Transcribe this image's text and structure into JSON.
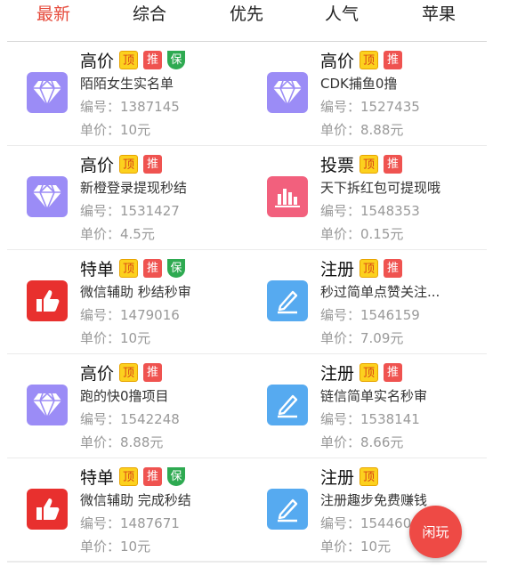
{
  "tabs": [
    {
      "label": "最新",
      "active": true
    },
    {
      "label": "综合",
      "active": false
    },
    {
      "label": "优先",
      "active": false
    },
    {
      "label": "人气",
      "active": false
    },
    {
      "label": "苹果",
      "active": false
    }
  ],
  "colors": {
    "accent": "#e64a3b",
    "diamond": "#9b8cf6",
    "chart": "#f2607d",
    "thumb": "#e8302e",
    "pen": "#56aaf0",
    "ding": "#fcd11e",
    "tui": "#ef5350",
    "bao": "#2eaa51"
  },
  "badge_labels": {
    "ding": "顶",
    "tui": "推",
    "bao": "保"
  },
  "labels": {
    "num_prefix": "编号：",
    "price_prefix": "单价："
  },
  "items": [
    {
      "title": "高价",
      "badges": [
        "ding",
        "tui",
        "bao"
      ],
      "icon": "diamond-icon",
      "desc": "陌陌女生实名单",
      "num": "编号：1387145",
      "price": "单价：10元"
    },
    {
      "title": "高价",
      "badges": [
        "ding",
        "tui"
      ],
      "icon": "diamond-icon",
      "desc": "CDK捕鱼0撸",
      "num": "编号：1527435",
      "price": "单价：8.88元"
    },
    {
      "title": "高价",
      "badges": [
        "ding",
        "tui"
      ],
      "icon": "diamond-icon",
      "desc": "新橙登录提现秒结",
      "num": "编号：1531427",
      "price": "单价：4.5元"
    },
    {
      "title": "投票",
      "badges": [
        "ding",
        "tui"
      ],
      "icon": "bar-chart-icon",
      "desc": "天下拆红包可提现哦",
      "num": "编号：1548353",
      "price": "单价：0.15元"
    },
    {
      "title": "特单",
      "badges": [
        "ding",
        "tui",
        "bao"
      ],
      "icon": "thumbs-up-icon",
      "desc": "微信辅助 秒结秒审",
      "num": "编号：1479016",
      "price": "单价：10元"
    },
    {
      "title": "注册",
      "badges": [
        "ding",
        "tui"
      ],
      "icon": "pen-icon",
      "desc": "秒过简单点赞关注...",
      "num": "编号：1546159",
      "price": "单价：7.09元"
    },
    {
      "title": "高价",
      "badges": [
        "ding",
        "tui"
      ],
      "icon": "diamond-icon",
      "desc": "跑的快0撸项目",
      "num": "编号：1542248",
      "price": "单价：8.88元"
    },
    {
      "title": "注册",
      "badges": [
        "ding",
        "tui"
      ],
      "icon": "pen-icon",
      "desc": "链信简单实名秒审",
      "num": "编号：1538141",
      "price": "单价：8.66元"
    },
    {
      "title": "特单",
      "badges": [
        "ding",
        "tui",
        "bao"
      ],
      "icon": "thumbs-up-icon",
      "desc": "微信辅助 完成秒结",
      "num": "编号：1487671",
      "price": "单价：10元"
    },
    {
      "title": "注册",
      "badges": [
        "ding"
      ],
      "icon": "pen-icon",
      "desc": "注册趣步免费赚钱",
      "num": "编号：154460",
      "price": "单价：10元"
    }
  ],
  "fab": {
    "label": "闲玩"
  }
}
